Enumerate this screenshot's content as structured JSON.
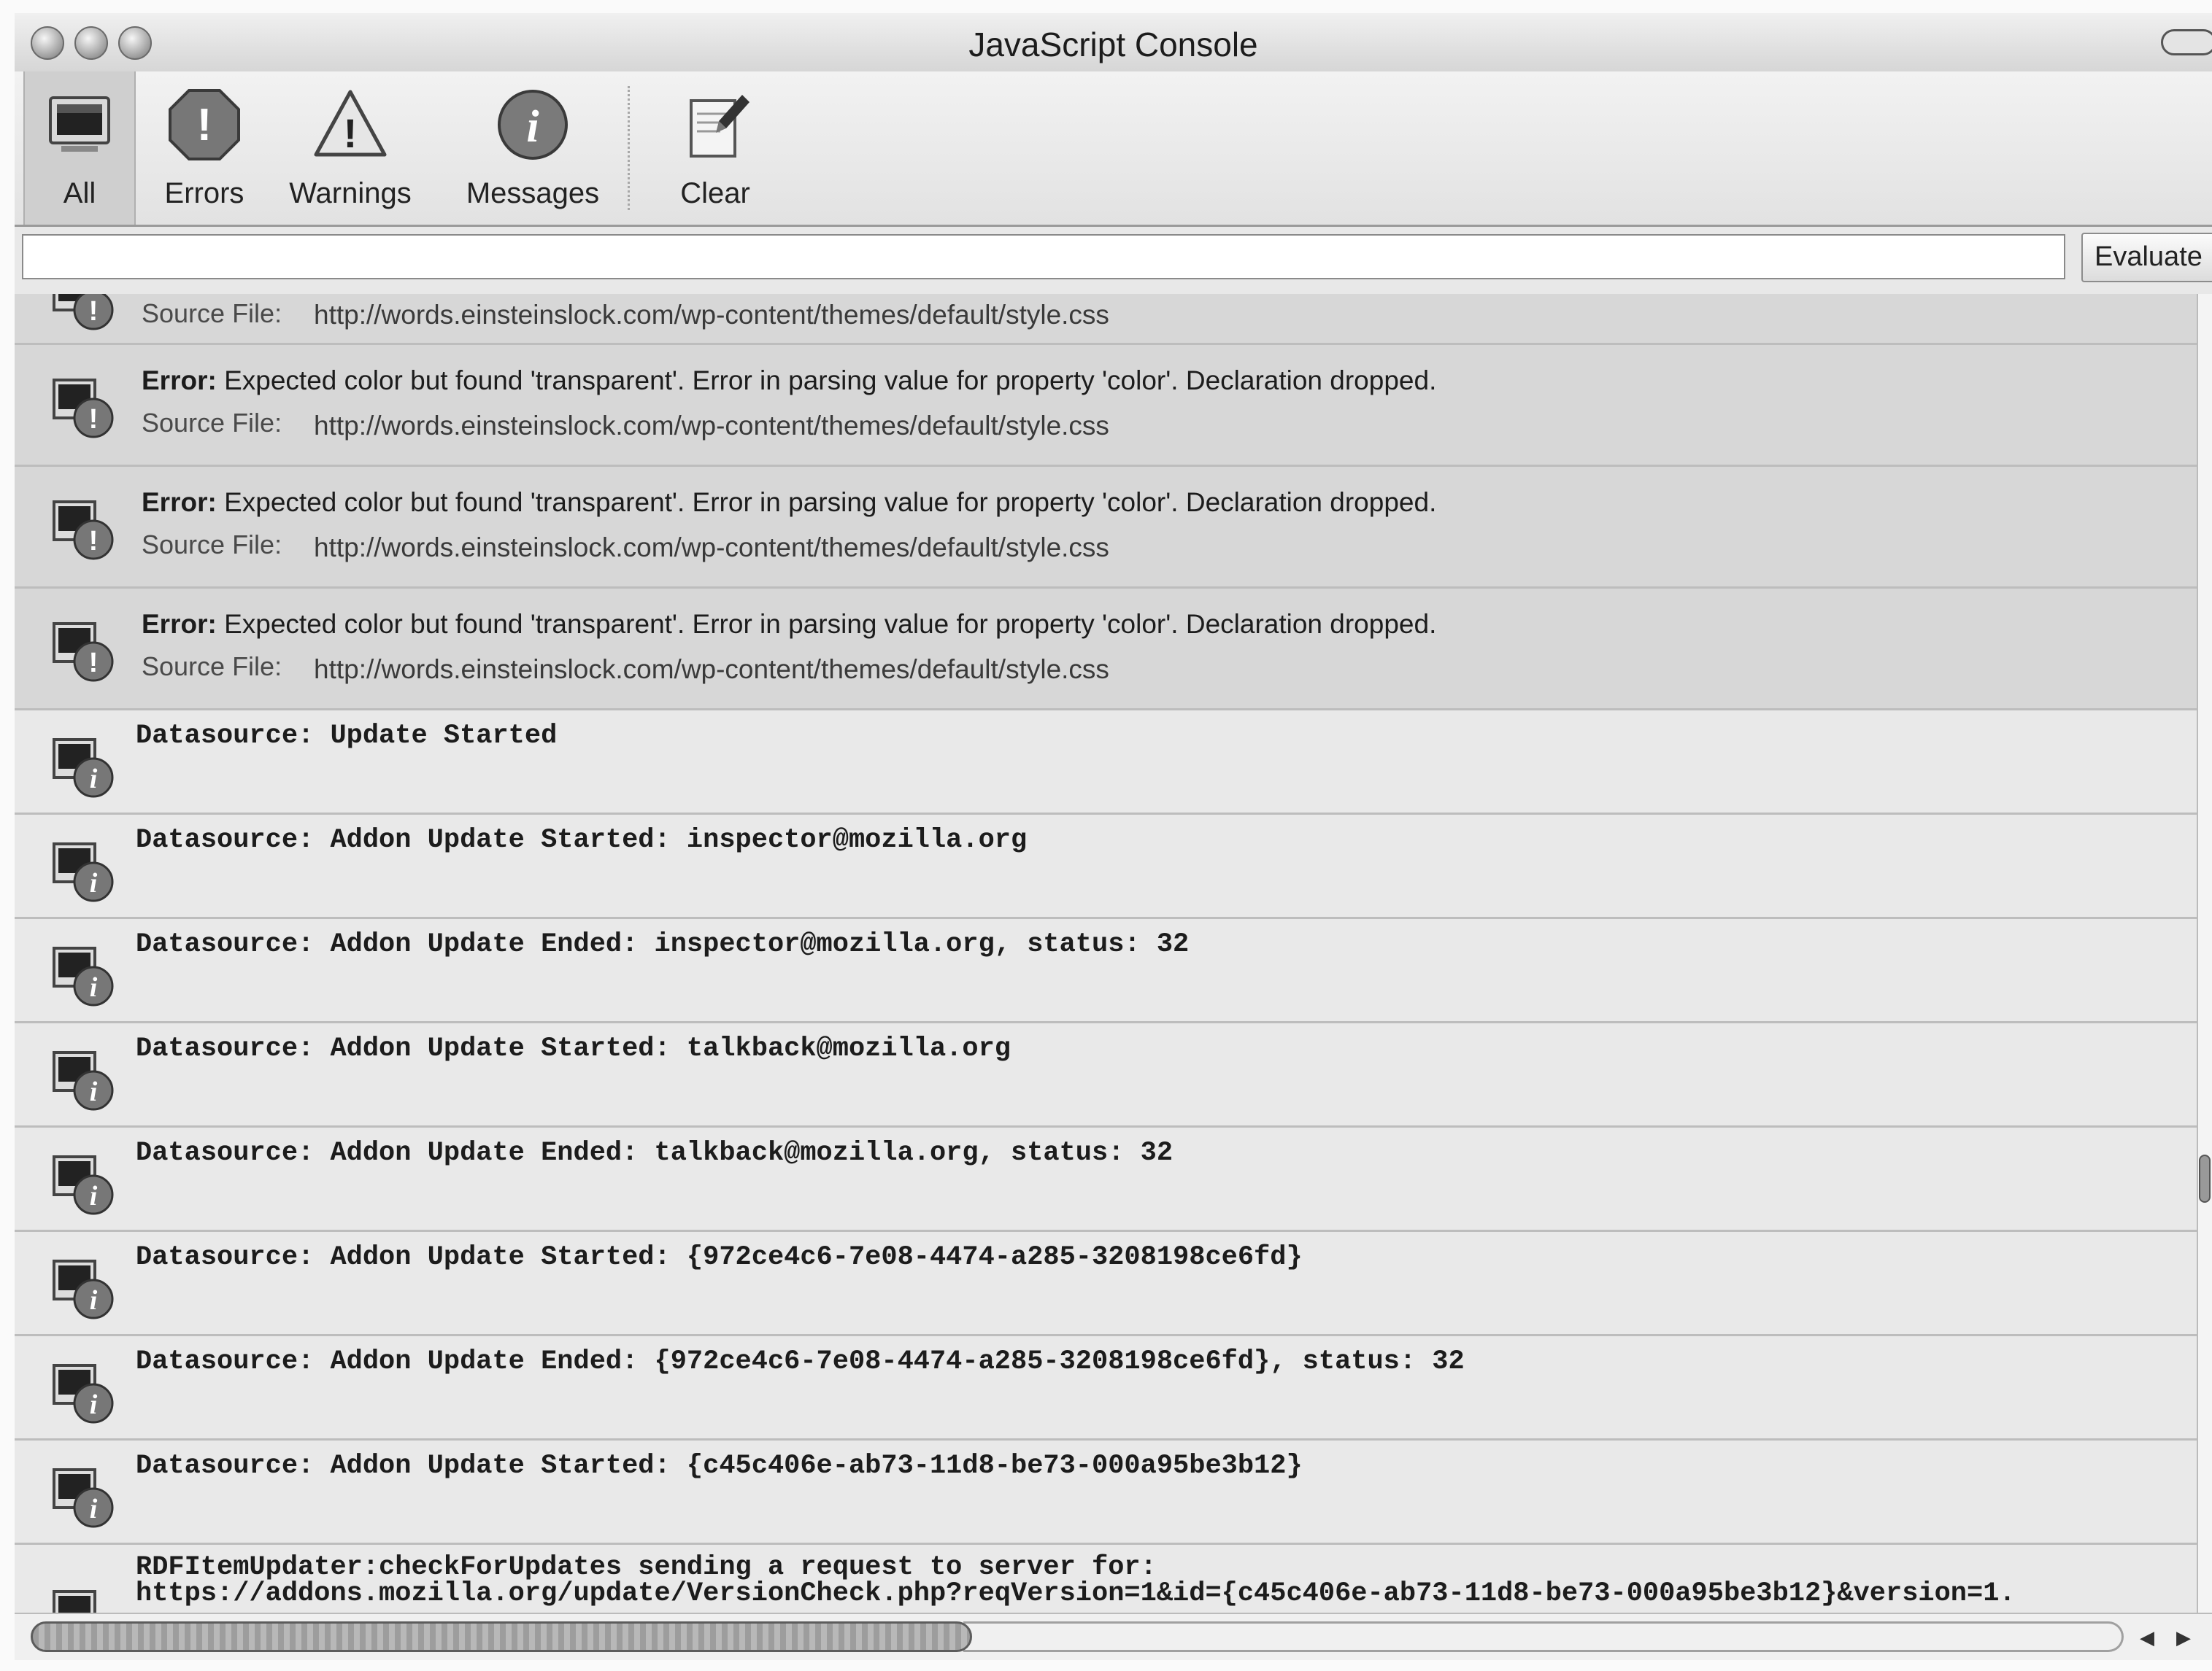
{
  "window": {
    "title": "JavaScript Console"
  },
  "toolbar": {
    "buttons": [
      {
        "label": "All",
        "icon": "monitor-icon",
        "active": true
      },
      {
        "label": "Errors",
        "icon": "error-icon"
      },
      {
        "label": "Warnings",
        "icon": "warning-icon"
      },
      {
        "label": "Messages",
        "icon": "info-icon"
      },
      {
        "label": "Clear",
        "icon": "clear-icon"
      }
    ]
  },
  "evaluate": {
    "value": "",
    "button_label": "Evaluate"
  },
  "source_label": "Source File:",
  "messages": [
    {
      "type": "error",
      "partial": true,
      "source": "http://words.einsteinslock.com/wp-content/themes/default/style.css"
    },
    {
      "type": "error",
      "prefix": "Error:",
      "text": " Expected color but found 'transparent'. Error in parsing value for property 'color'. Declaration dropped.",
      "source": "http://words.einsteinslock.com/wp-content/themes/default/style.css"
    },
    {
      "type": "error",
      "prefix": "Error:",
      "text": " Expected color but found 'transparent'. Error in parsing value for property 'color'. Declaration dropped.",
      "source": "http://words.einsteinslock.com/wp-content/themes/default/style.css"
    },
    {
      "type": "error",
      "prefix": "Error:",
      "text": " Expected color but found 'transparent'. Error in parsing value for property 'color'. Declaration dropped.",
      "source": "http://words.einsteinslock.com/wp-content/themes/default/style.css"
    },
    {
      "type": "message",
      "text": "Datasource: Update Started"
    },
    {
      "type": "message",
      "text": "Datasource: Addon Update Started: inspector@mozilla.org"
    },
    {
      "type": "message",
      "text": "Datasource: Addon Update Ended: inspector@mozilla.org, status: 32"
    },
    {
      "type": "message",
      "text": "Datasource: Addon Update Started: talkback@mozilla.org"
    },
    {
      "type": "message",
      "text": "Datasource: Addon Update Ended: talkback@mozilla.org, status: 32"
    },
    {
      "type": "message",
      "text": "Datasource: Addon Update Started: {972ce4c6-7e08-4474-a285-3208198ce6fd}"
    },
    {
      "type": "message",
      "text": "Datasource: Addon Update Ended: {972ce4c6-7e08-4474-a285-3208198ce6fd}, status: 32"
    },
    {
      "type": "message",
      "text": "Datasource: Addon Update Started: {c45c406e-ab73-11d8-be73-000a95be3b12}"
    },
    {
      "type": "message",
      "partial": true,
      "text": "RDFItemUpdater:checkForUpdates sending a request to server for:",
      "text2": "https://addons.mozilla.org/update/VersionCheck.php?reqVersion=1&id={c45c406e-ab73-11d8-be73-000a95be3b12}&version=1."
    }
  ],
  "colors": {
    "error_row": "#d7d7d7",
    "message_row": "#e9e9e9"
  }
}
